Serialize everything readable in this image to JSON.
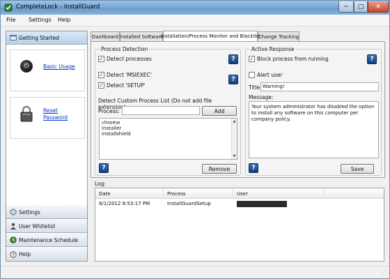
{
  "window": {
    "title": "CompleteLock - InstallGuard",
    "minimize_symbol": "─",
    "maximize_symbol": "□",
    "close_symbol": "✕"
  },
  "menu": [
    "File",
    "Settings",
    "Help"
  ],
  "sidebar": {
    "header": "Getting Started",
    "links": [
      "Basic Usage",
      "Reset Password"
    ],
    "footer_items": [
      "Settings",
      "User Whitelist",
      "Maintenance Schedule",
      "Help"
    ]
  },
  "tabs": [
    "Dashboard",
    "Installed Software",
    "Installation/Process Monitor and Blacklist",
    "Change Tracking"
  ],
  "active_tab": "Installation/Process Monitor and Blacklist",
  "process_detection": {
    "title": "Process Detection",
    "detect_processes": {
      "label": "Detect processes",
      "checked": true
    },
    "detect_msiexec": {
      "label": "Detect 'MSIEXEC'",
      "checked": true
    },
    "detect_setup": {
      "label": "Detect 'SETUP'",
      "checked": true
    },
    "custom_list_label": "Detect Custom Process List (Do not add file extension):",
    "process_label": "Process:",
    "process_value": "",
    "add_button": "Add",
    "process_list": [
      "chrome",
      "installer",
      "installshield"
    ],
    "remove_button": "Remove"
  },
  "active_response": {
    "title": "Active Response",
    "block_process": {
      "label": "Block process from running",
      "checked": true
    },
    "alert_user": {
      "label": "Alert user",
      "checked": false
    },
    "title_label": "Title:",
    "title_value": "Warning!",
    "message_label": "Message:",
    "message_value": "Your system administrator has disabled the option to install any software on this computer per company policy.",
    "save_button": "Save"
  },
  "help_symbol": "?",
  "log": {
    "label": "Log:",
    "columns": [
      "Date",
      "Process",
      "User"
    ],
    "rows": [
      {
        "date": "8/1/2012 8:53:17 PM",
        "process": "InstallGuardSetup",
        "user": ""
      }
    ]
  },
  "colors": {
    "accent": "#3b6fb0",
    "link": "#0033cc",
    "titlebar": "#7ea9d6"
  }
}
